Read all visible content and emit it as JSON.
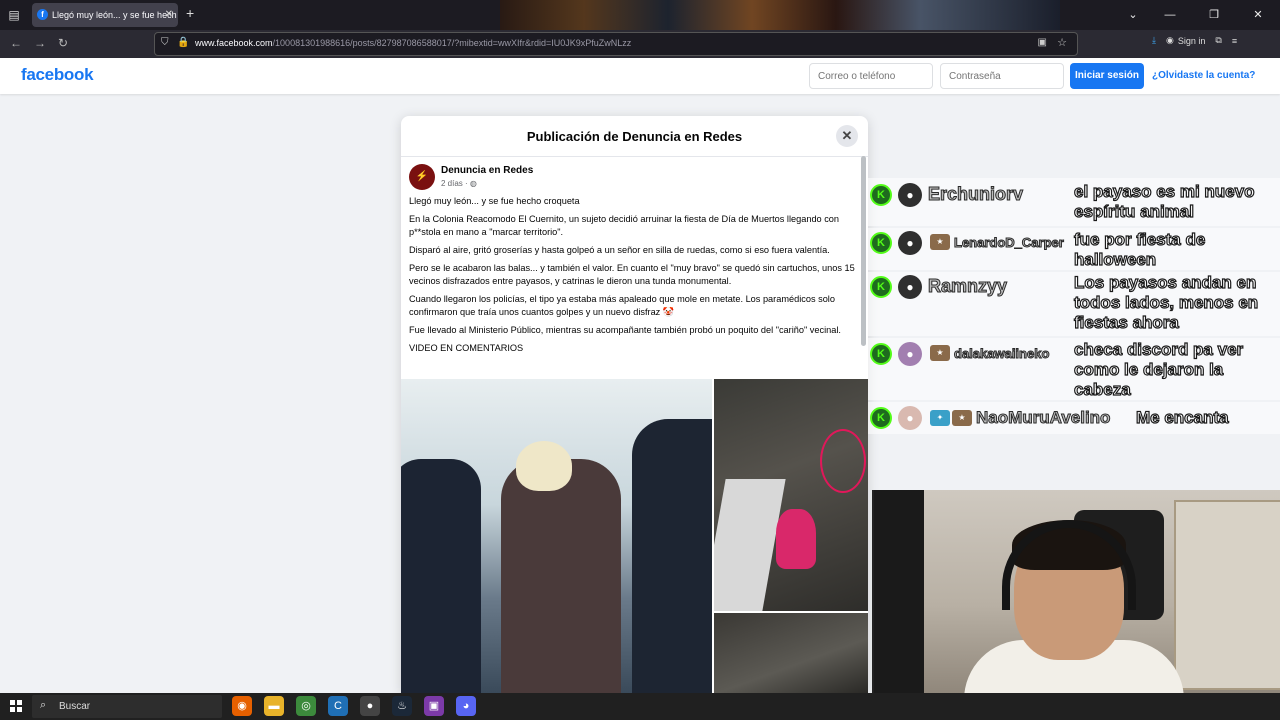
{
  "browser": {
    "tab_title": "Llegó muy león... y se fue hech",
    "url_host": "www.facebook.com",
    "url_path": "/100081301988616/posts/827987086588017/?mibextid=wwXIfr&rdid=IU0JK9xPfuZwNLzz",
    "sign_in_label": "Sign in"
  },
  "header": {
    "logo": "facebook",
    "email_placeholder": "Correo o teléfono",
    "password_placeholder": "Contraseña",
    "login_label": "Iniciar sesión",
    "forgot_label": "¿Olvidaste la cuenta?"
  },
  "modal": {
    "title": "Publicación de Denuncia en Redes",
    "author": "Denuncia en Redes",
    "time": "2 días",
    "paragraphs": [
      "Llegó muy león... y se fue hecho croqueta",
      "En la Colonia Reacomodo El Cuernito, un sujeto decidió arruinar la fiesta de Día de Muertos llegando con p**stola en mano a \"marcar territorio\".",
      "Disparó al aire, gritó groserías y hasta golpeó a un señor en silla de ruedas, como si eso fuera valentía.",
      "Pero se le acabaron las balas... y también el valor. En cuanto el \"muy bravo\" se quedó sin cartuchos, unos 15 vecinos disfrazados entre payasos, y catrinas le dieron una tunda monumental.",
      "Cuando llegaron los policías, el tipo ya estaba más apaleado que mole en metate. Los paramédicos solo confirmaron que traía unos cuantos golpes y un nuevo disfraz 🤡",
      "Fue llevado al Ministerio Público, mientras su acompañante también probó un poquito del \"cariño\" vecinal.",
      "VIDEO EN COMENTARIOS"
    ]
  },
  "chat": [
    {
      "user": "Erchuniorv",
      "message": "el payaso es mi nuevo espíritu animal"
    },
    {
      "user": "LenardoD_Carper",
      "message": "fue por fiesta de halloween"
    },
    {
      "user": "Ramnzyy",
      "message": "Los payasos andan en todos lados, menos en fiestas ahora"
    },
    {
      "user": "dalakawaiineko",
      "message": "checa discord pa ver como le dejaron la cabeza"
    },
    {
      "user": "NaoMuruAvelino",
      "message": "Me encanta"
    }
  ],
  "taskbar": {
    "search_label": "Buscar"
  },
  "colors": {
    "facebook_blue": "#1877f2",
    "kick_green": "#53fc18"
  }
}
